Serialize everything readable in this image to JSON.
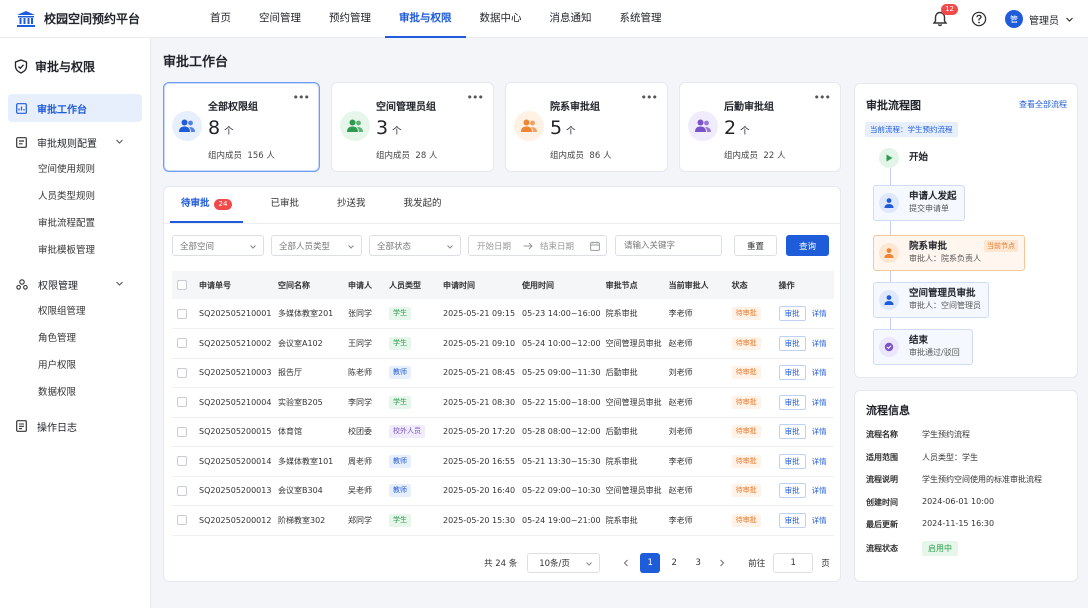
{
  "app": {
    "title": "校园空间预约平台"
  },
  "nav": [
    {
      "label": "首页",
      "active": false
    },
    {
      "label": "空间管理",
      "active": false
    },
    {
      "label": "预约管理",
      "active": false
    },
    {
      "label": "审批与权限",
      "active": true
    },
    {
      "label": "数据中心",
      "active": false
    },
    {
      "label": "消息通知",
      "active": false
    },
    {
      "label": "系统管理",
      "active": false
    }
  ],
  "header": {
    "notification_count": "12",
    "avatar_text": "管",
    "user_name": "管理员"
  },
  "sidebar": {
    "title": "审批与权限",
    "workbench": "审批工作台",
    "rules": {
      "label": "审批规则配置",
      "items": [
        "空间使用规则",
        "人员类型规则",
        "审批流程配置",
        "审批模板管理"
      ]
    },
    "perms": {
      "label": "权限管理",
      "items": [
        "权限组管理",
        "角色管理",
        "用户权限",
        "数据权限"
      ]
    },
    "log": "操作日志"
  },
  "page_title": "审批工作台",
  "group_cards": [
    {
      "name": "全部权限组",
      "count": "8",
      "unit": "个",
      "members_label": "组内成员",
      "members": "156 人",
      "color": "#1f5cd9",
      "bg": "#e8effc",
      "icon": "users-icon"
    },
    {
      "name": "空间管理员组",
      "count": "3",
      "unit": "个",
      "members_label": "组内成员",
      "members": "28 人",
      "color": "#2e9a4f",
      "bg": "#e6f6ea",
      "icon": "users-icon"
    },
    {
      "name": "院系审批组",
      "count": "5",
      "unit": "个",
      "members_label": "组内成员",
      "members": "86 人",
      "color": "#ee8434",
      "bg": "#fff1e4",
      "icon": "users-icon"
    },
    {
      "name": "后勤审批组",
      "count": "2",
      "unit": "个",
      "members_label": "组内成员",
      "members": "22 人",
      "color": "#7a53c9",
      "bg": "#f1ecfb",
      "icon": "users-icon"
    }
  ],
  "tabs": [
    {
      "label": "待审批",
      "badge": "24",
      "active": true
    },
    {
      "label": "已审批",
      "active": false
    },
    {
      "label": "抄送我",
      "active": false
    },
    {
      "label": "我发起的",
      "active": false
    }
  ],
  "filters": {
    "space": "全部空间",
    "person_type": "全部人员类型",
    "status": "全部状态",
    "start_placeholder": "开始日期",
    "end_placeholder": "结束日期",
    "keyword_placeholder": "请输入关键字",
    "reset": "重置",
    "search": "查询"
  },
  "table": {
    "columns": [
      "申请单号",
      "空间名称",
      "申请人",
      "人员类型",
      "申请时间",
      "使用时间",
      "审批节点",
      "当前审批人",
      "状态",
      "操作"
    ],
    "approve_label": "审批",
    "detail_label": "详情",
    "rows": [
      [
        "SQ202505210001",
        "多媒体教室201",
        "张同学",
        "学生",
        "2025-05-21 09:15",
        "05-23 14:00~16:00",
        "院系审批",
        "李老师",
        "待审批"
      ],
      [
        "SQ202505210002",
        "会议室A102",
        "王同学",
        "学生",
        "2025-05-21 09:10",
        "05-24 10:00~12:00",
        "空间管理员审批",
        "赵老师",
        "待审批"
      ],
      [
        "SQ202505210003",
        "报告厅",
        "陈老师",
        "教师",
        "2025-05-21 08:45",
        "05-25 09:00~11:30",
        "后勤审批",
        "刘老师",
        "待审批"
      ],
      [
        "SQ202505210004",
        "实验室B205",
        "李同学",
        "学生",
        "2025-05-21 08:30",
        "05-22 15:00~18:00",
        "空间管理员审批",
        "赵老师",
        "待审批"
      ],
      [
        "SQ202505200015",
        "体育馆",
        "校团委",
        "校外人员",
        "2025-05-20 17:20",
        "05-28 08:00~12:00",
        "后勤审批",
        "刘老师",
        "待审批"
      ],
      [
        "SQ202505200014",
        "多媒体教室101",
        "周老师",
        "教师",
        "2025-05-20 16:55",
        "05-21 13:30~15:30",
        "院系审批",
        "李老师",
        "待审批"
      ],
      [
        "SQ202505200013",
        "会议室B304",
        "吴老师",
        "教师",
        "2025-05-20 16:40",
        "05-22 09:00~10:30",
        "空间管理员审批",
        "赵老师",
        "待审批"
      ],
      [
        "SQ202505200012",
        "阶梯教室302",
        "郑同学",
        "学生",
        "2025-05-20 15:30",
        "05-24 19:00~21:00",
        "院系审批",
        "李老师",
        "待审批"
      ]
    ]
  },
  "pagination": {
    "total": "共 24 条",
    "page_size": "10条/页",
    "pages": [
      "1",
      "2",
      "3"
    ],
    "current": "1",
    "goto_label": "前往",
    "goto_value": "1",
    "page_suffix": "页"
  },
  "flow": {
    "title": "审批流程图",
    "view_all": "查看全部流程",
    "current_label": "当前流程：学生预约流程",
    "current_badge": "当前节点",
    "nodes": [
      {
        "name": "开始",
        "sub": ""
      },
      {
        "name": "申请人发起",
        "sub": "提交申请单"
      },
      {
        "name": "院系审批",
        "sub": "审批人：院系负责人"
      },
      {
        "name": "空间管理员审批",
        "sub": "审批人：空间管理员"
      },
      {
        "name": "结束",
        "sub": "审批通过/驳回"
      }
    ]
  },
  "info": {
    "title": "流程信息",
    "rows": [
      {
        "key": "流程名称",
        "value": "学生预约流程"
      },
      {
        "key": "适用范围",
        "value": "人员类型：学生"
      },
      {
        "key": "流程说明",
        "value": "学生预约空间使用的标准审批流程"
      },
      {
        "key": "创建时间",
        "value": "2024-06-01  10:00"
      },
      {
        "key": "最后更新",
        "value": "2024-11-15  16:30"
      },
      {
        "key": "流程状态",
        "value": "启用中"
      }
    ]
  }
}
